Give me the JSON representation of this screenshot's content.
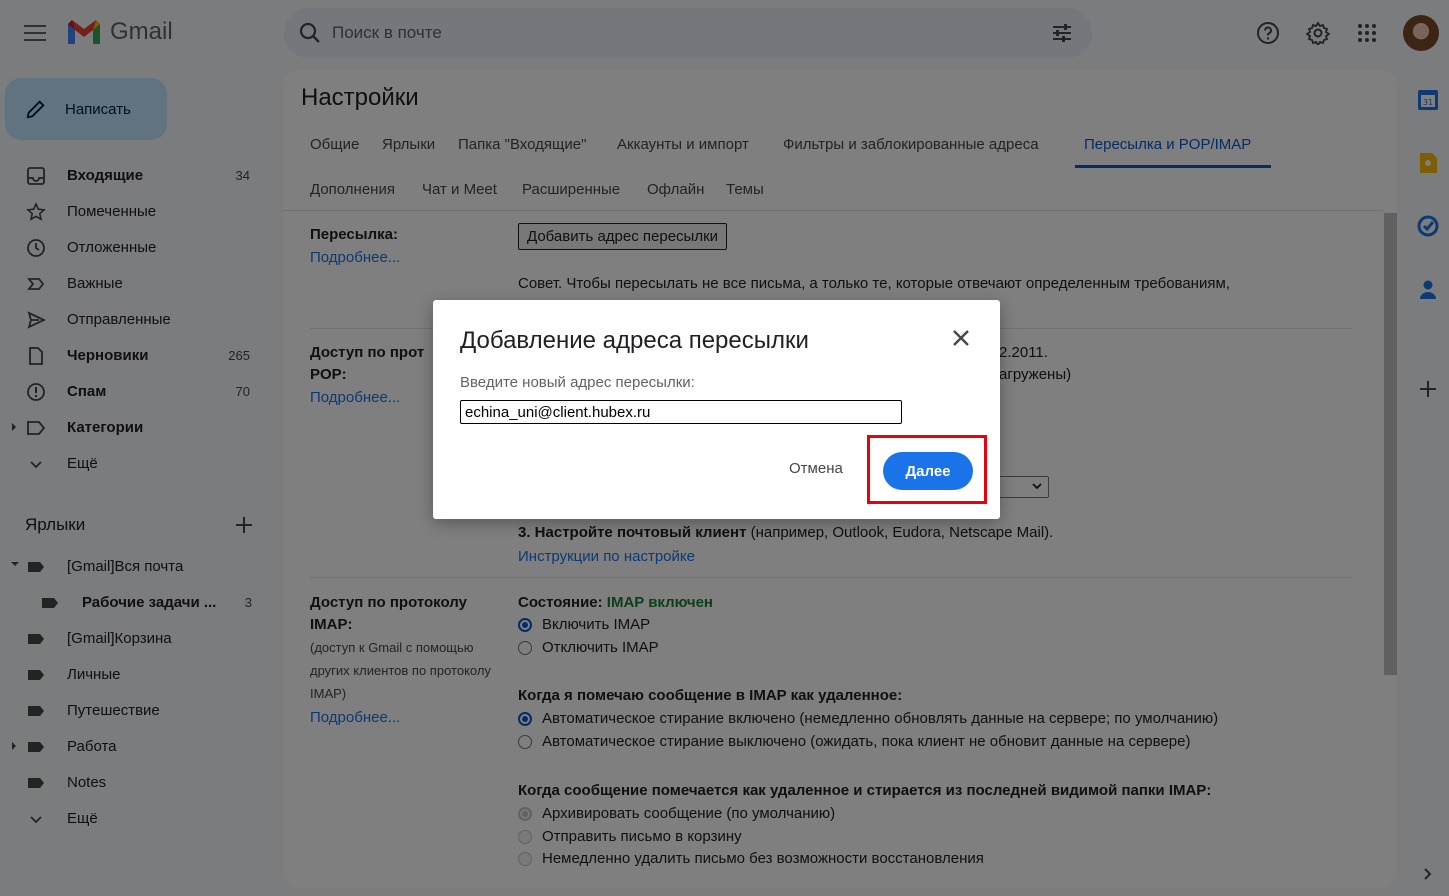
{
  "app": {
    "name": "Gmail"
  },
  "search": {
    "placeholder": "Поиск в почте"
  },
  "compose": {
    "label": "Написать"
  },
  "nav": [
    {
      "label": "Входящие",
      "count": "34",
      "bold": true,
      "icon": "inbox-icon"
    },
    {
      "label": "Помеченные",
      "count": "",
      "bold": false,
      "icon": "star-icon"
    },
    {
      "label": "Отложенные",
      "count": "",
      "bold": false,
      "icon": "clock-icon"
    },
    {
      "label": "Важные",
      "count": "",
      "bold": false,
      "icon": "important-icon"
    },
    {
      "label": "Отправленные",
      "count": "",
      "bold": false,
      "icon": "send-icon"
    },
    {
      "label": "Черновики",
      "count": "265",
      "bold": true,
      "icon": "draft-icon"
    },
    {
      "label": "Спам",
      "count": "70",
      "bold": true,
      "icon": "spam-icon"
    },
    {
      "label": "Категории",
      "count": "",
      "bold": true,
      "icon": "category-icon"
    },
    {
      "label": "Ещё",
      "count": "",
      "bold": false,
      "icon": "chevron-down-icon"
    }
  ],
  "labels": {
    "heading": "Ярлыки",
    "items": [
      {
        "label": "[Gmail]Вся почта",
        "count": ""
      },
      {
        "label": "Рабочие задачи ...",
        "count": "3"
      },
      {
        "label": "[Gmail]Корзина",
        "count": ""
      },
      {
        "label": "Личные",
        "count": ""
      },
      {
        "label": "Путешествие",
        "count": ""
      },
      {
        "label": "Работа",
        "count": ""
      },
      {
        "label": "Notes",
        "count": ""
      },
      {
        "label": "Ещё",
        "count": ""
      }
    ]
  },
  "settings": {
    "title": "Настройки",
    "tabs": [
      "Общие",
      "Ярлыки",
      "Папка \"Входящие\"",
      "Аккаунты и импорт",
      "Фильтры и заблокированные адреса",
      "Пересылка и POP/IMAP",
      "Дополнения",
      "Чат и Meet",
      "Расширенные",
      "Офлайн",
      "Темы"
    ],
    "active_tab": "Пересылка и POP/IMAP",
    "forwarding": {
      "label": "Пересылка:",
      "more": "Подробнее...",
      "add_button": "Добавить адрес пересылки",
      "tip": "Совет. Чтобы пересылать не все письма, а только те, которые отвечают определенным требованиям,"
    },
    "pop": {
      "label_line1": "Доступ по прот",
      "label_line2": "POP:",
      "more": "Подробнее...",
      "text1": "2.2011.",
      "text2": "агружены)",
      "step3_bold": "3. Настройте почтовый клиент",
      "step3_rest": " (например, Outlook, Eudora, Netscape Mail).",
      "instructions": "Инструкции по настройке"
    },
    "imap": {
      "label_line1": "Доступ по протоколу",
      "label_line2": "IMAP:",
      "desc_line1": "(доступ к Gmail с помощью",
      "desc_line2": "других клиентов по протоколу",
      "desc_line3": "IMAP)",
      "more": "Подробнее...",
      "status_label": "Состояние:",
      "status_value": "IMAP включен",
      "enable": "Включить IMAP",
      "disable": "Отключить IMAP",
      "deleted_heading": "Когда я помечаю сообщение в IMAP как удаленное:",
      "auto_expunge_on": "Автоматическое стирание включено (немедленно обновлять данные на сервере; по умолчанию)",
      "auto_expunge_off": "Автоматическое стирание выключено (ожидать, пока клиент не обновит данные на сервере)",
      "expunge_heading": "Когда сообщение помечается как удаленное и стирается из последней видимой папки IMAP:",
      "archive": "Архивировать сообщение (по умолчанию)",
      "trash": "Отправить письмо в корзину",
      "delete_forever": "Немедленно удалить письмо без возможности восстановления"
    }
  },
  "dialog": {
    "title": "Добавление адреса пересылки",
    "prompt": "Введите новый адрес пересылки:",
    "input_value": "echina_uni@client.hubex.ru",
    "cancel": "Отмена",
    "next": "Далее"
  },
  "colors": {
    "accent": "#0b57d0",
    "compose_bg": "#c2e7ff",
    "highlight": "#e8000b",
    "status_green": "#188038"
  }
}
